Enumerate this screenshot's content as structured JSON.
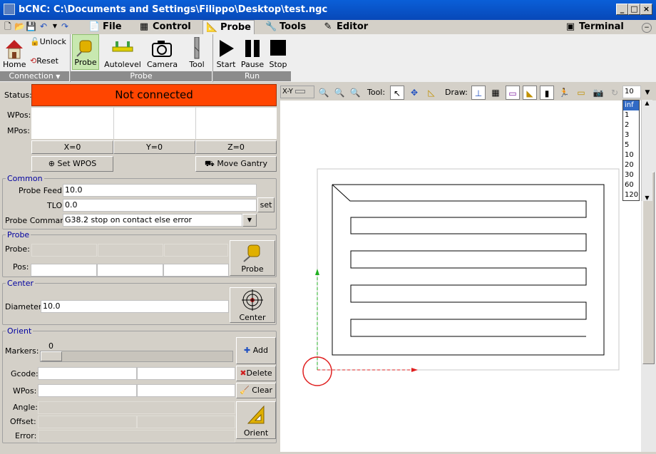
{
  "window": {
    "title": "bCNC: C:\\Documents and Settings\\Filippo\\Desktop\\test.ngc"
  },
  "tabs": [
    {
      "label": "File",
      "icon": "file-icon"
    },
    {
      "label": "Control",
      "icon": "control-icon"
    },
    {
      "label": "Probe",
      "icon": "probe-tab-icon"
    },
    {
      "label": "Tools",
      "icon": "tools-icon"
    },
    {
      "label": "Editor",
      "icon": "editor-icon"
    },
    {
      "label": "Terminal",
      "icon": "terminal-icon"
    }
  ],
  "ribbon": {
    "home": "Home",
    "unlock": "Unlock",
    "reset": "Reset",
    "probe": "Probe",
    "autolevel": "Autolevel",
    "camera": "Camera",
    "tool": "Tool",
    "start": "Start",
    "pause": "Pause",
    "stop": "Stop",
    "groups": {
      "connection": "Connection",
      "probe": "Probe",
      "run": "Run"
    }
  },
  "status": {
    "label": "Status:",
    "value": "Not connected",
    "color": "#ff4500",
    "wpos_label": "WPos:",
    "mpos_label": "MPos:",
    "x_btn": "X=0",
    "y_btn": "Y=0",
    "z_btn": "Z=0",
    "set_wpos": "Set WPOS",
    "move_gantry": "Move Gantry"
  },
  "common": {
    "title": "Common",
    "probe_feed_label": "Probe Feed:",
    "probe_feed": "10.0",
    "tlo_label": "TLO",
    "tlo": "0.0",
    "set": "set",
    "probe_command_label": "Probe Command",
    "probe_command": "G38.2 stop on contact else error"
  },
  "probe": {
    "title": "Probe",
    "probe_label": "Probe:",
    "pos_label": "Pos:",
    "button": "Probe"
  },
  "center": {
    "title": "Center",
    "diameter_label": "Diameter:",
    "diameter": "10.0",
    "button": "Center"
  },
  "orient": {
    "title": "Orient",
    "markers_label": "Markers:",
    "markers_value": "0",
    "gcode_label": "Gcode:",
    "wpos_label": "WPos:",
    "angle_label": "Angle:",
    "offset_label": "Offset:",
    "error_label": "Error:",
    "add": "Add",
    "delete": "Delete",
    "clear": "Clear",
    "orient_btn": "Orient"
  },
  "canvas_toolbar": {
    "view": "X-Y",
    "tool_label": "Tool:",
    "draw_label": "Draw:",
    "zoom_value": "10",
    "zoom_options": [
      "inf",
      "1",
      "2",
      "3",
      "5",
      "10",
      "20",
      "30",
      "60",
      "120"
    ]
  }
}
